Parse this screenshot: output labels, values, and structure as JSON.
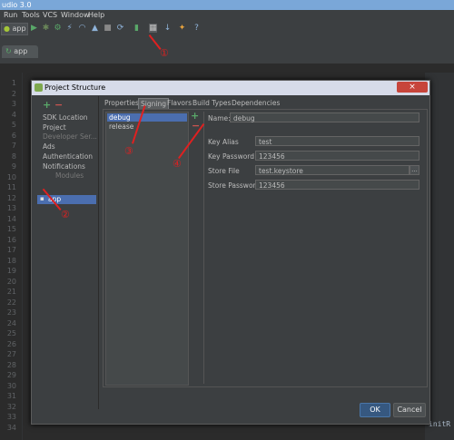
{
  "window": {
    "title": "udio 3.0"
  },
  "menubar": {
    "items": [
      "Run",
      "Tools",
      "VCS",
      "Window",
      "Help"
    ]
  },
  "toolbar": {
    "run_config": "app"
  },
  "editor_tab": {
    "label": "app"
  },
  "line_numbers": [
    "1",
    "2",
    "3",
    "4",
    "5",
    "6",
    "7",
    "8",
    "9",
    "10",
    "11",
    "12",
    "13",
    "14",
    "15",
    "16",
    "17",
    "18",
    "19",
    "20",
    "21",
    "22",
    "23",
    "24",
    "25",
    "26",
    "27",
    "28",
    "29",
    "30",
    "31",
    "32",
    "33",
    "34"
  ],
  "editor_right_text": "initR",
  "dialog": {
    "title": "Project Structure",
    "close_symbol": "×",
    "left_panel": {
      "add": "+",
      "remove": "−",
      "items": [
        "SDK Location",
        "Project",
        "Developer Ser...",
        "Ads",
        "Authentication",
        "Notifications",
        "Modules",
        "app"
      ]
    },
    "tabs": [
      "Properties",
      "Signing",
      "Flavors",
      "Build Types",
      "Dependencies"
    ],
    "signing": {
      "configs": [
        "debug",
        "release"
      ],
      "add": "+",
      "remove": "−",
      "name_label": "Name:",
      "name_value": "debug",
      "fields": [
        {
          "label": "Key Alias",
          "value": "test"
        },
        {
          "label": "Key Password",
          "value": "123456"
        },
        {
          "label": "Store File",
          "value": "test.keystore"
        },
        {
          "label": "Store Password",
          "value": "123456"
        }
      ],
      "browse": "..."
    },
    "ok": "OK",
    "cancel": "Cancel"
  },
  "annotations": [
    "①",
    "②",
    "③",
    "④"
  ],
  "colors": {
    "accent": "#4b6eaf",
    "annotation": "#e02020",
    "close": "#c7453b"
  }
}
